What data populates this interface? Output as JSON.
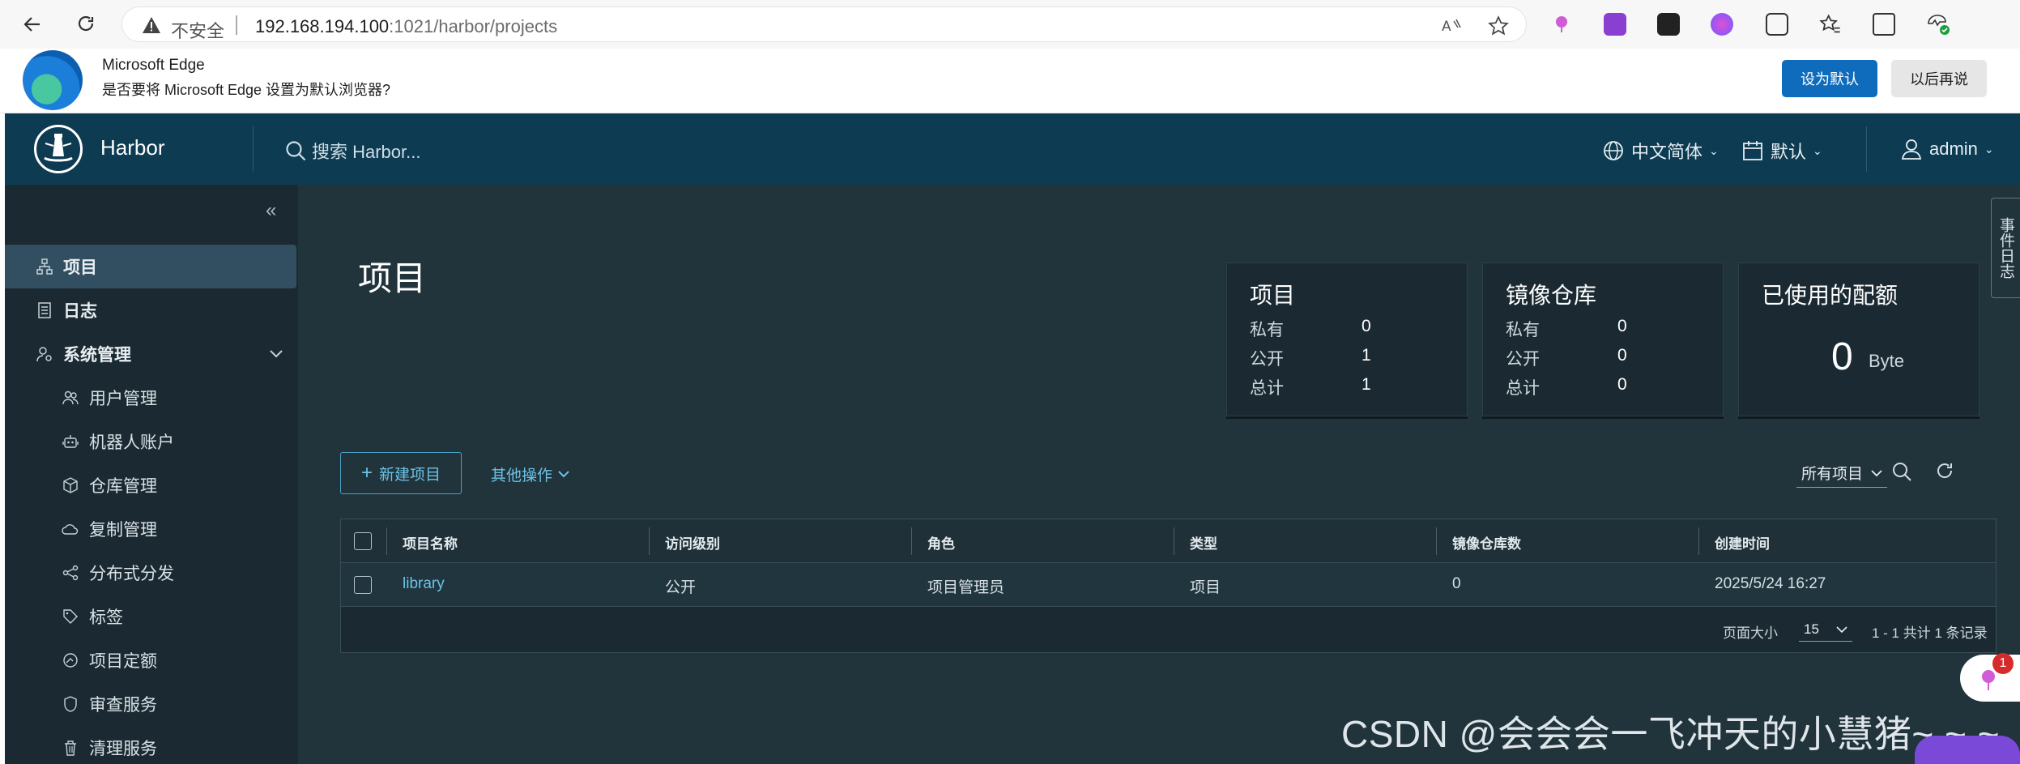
{
  "browser": {
    "insecure_label": "不安全",
    "url_host": "192.168.194.100",
    "url_rest": ":1021/harbor/projects"
  },
  "infobar": {
    "title": "Microsoft Edge",
    "message": "是否要将 Microsoft Edge 设置为默认浏览器?",
    "set_default": "设为默认",
    "later": "以后再说"
  },
  "header": {
    "brand": "Harbor",
    "search_placeholder": "搜索 Harbor...",
    "language": "中文简体",
    "theme": "默认",
    "user": "admin"
  },
  "sidebar": {
    "items": [
      {
        "label": "项目",
        "icon": "projects-icon"
      },
      {
        "label": "日志",
        "icon": "logs-icon"
      },
      {
        "label": "系统管理",
        "icon": "admin-icon"
      },
      {
        "label": "用户管理",
        "icon": "users-icon"
      },
      {
        "label": "机器人账户",
        "icon": "robot-icon"
      },
      {
        "label": "仓库管理",
        "icon": "registry-icon"
      },
      {
        "label": "复制管理",
        "icon": "replication-icon"
      },
      {
        "label": "分布式分发",
        "icon": "distribution-icon"
      },
      {
        "label": "标签",
        "icon": "tag-icon"
      },
      {
        "label": "项目定额",
        "icon": "quota-icon"
      },
      {
        "label": "审查服务",
        "icon": "shield-icon"
      },
      {
        "label": "清理服务",
        "icon": "trash-icon"
      }
    ]
  },
  "main": {
    "title": "项目",
    "cards": {
      "projects": {
        "title": "项目",
        "private_label": "私有",
        "private": "0",
        "public_label": "公开",
        "public": "1",
        "total_label": "总计",
        "total": "1"
      },
      "repos": {
        "title": "镜像仓库",
        "private_label": "私有",
        "private": "0",
        "public_label": "公开",
        "public": "0",
        "total_label": "总计",
        "total": "0"
      },
      "quota": {
        "title": "已使用的配额",
        "value": "0",
        "unit": "Byte"
      }
    },
    "new_project": "新建项目",
    "other_actions": "其他操作",
    "filter": "所有项目",
    "table": {
      "columns": [
        "项目名称",
        "访问级别",
        "角色",
        "类型",
        "镜像仓库数",
        "创建时间"
      ],
      "rows": [
        {
          "name": "library",
          "access": "公开",
          "role": "项目管理员",
          "type": "项目",
          "repos": "0",
          "created": "2025/5/24 16:27"
        }
      ],
      "page_size_label": "页面大小",
      "page_size": "15",
      "summary": "1 - 1 共计 1 条记录"
    }
  },
  "side_tab": "事件日志",
  "badge_count": "1",
  "watermark": "CSDN @会会会一飞冲天的小慧猪~ ~ ~"
}
